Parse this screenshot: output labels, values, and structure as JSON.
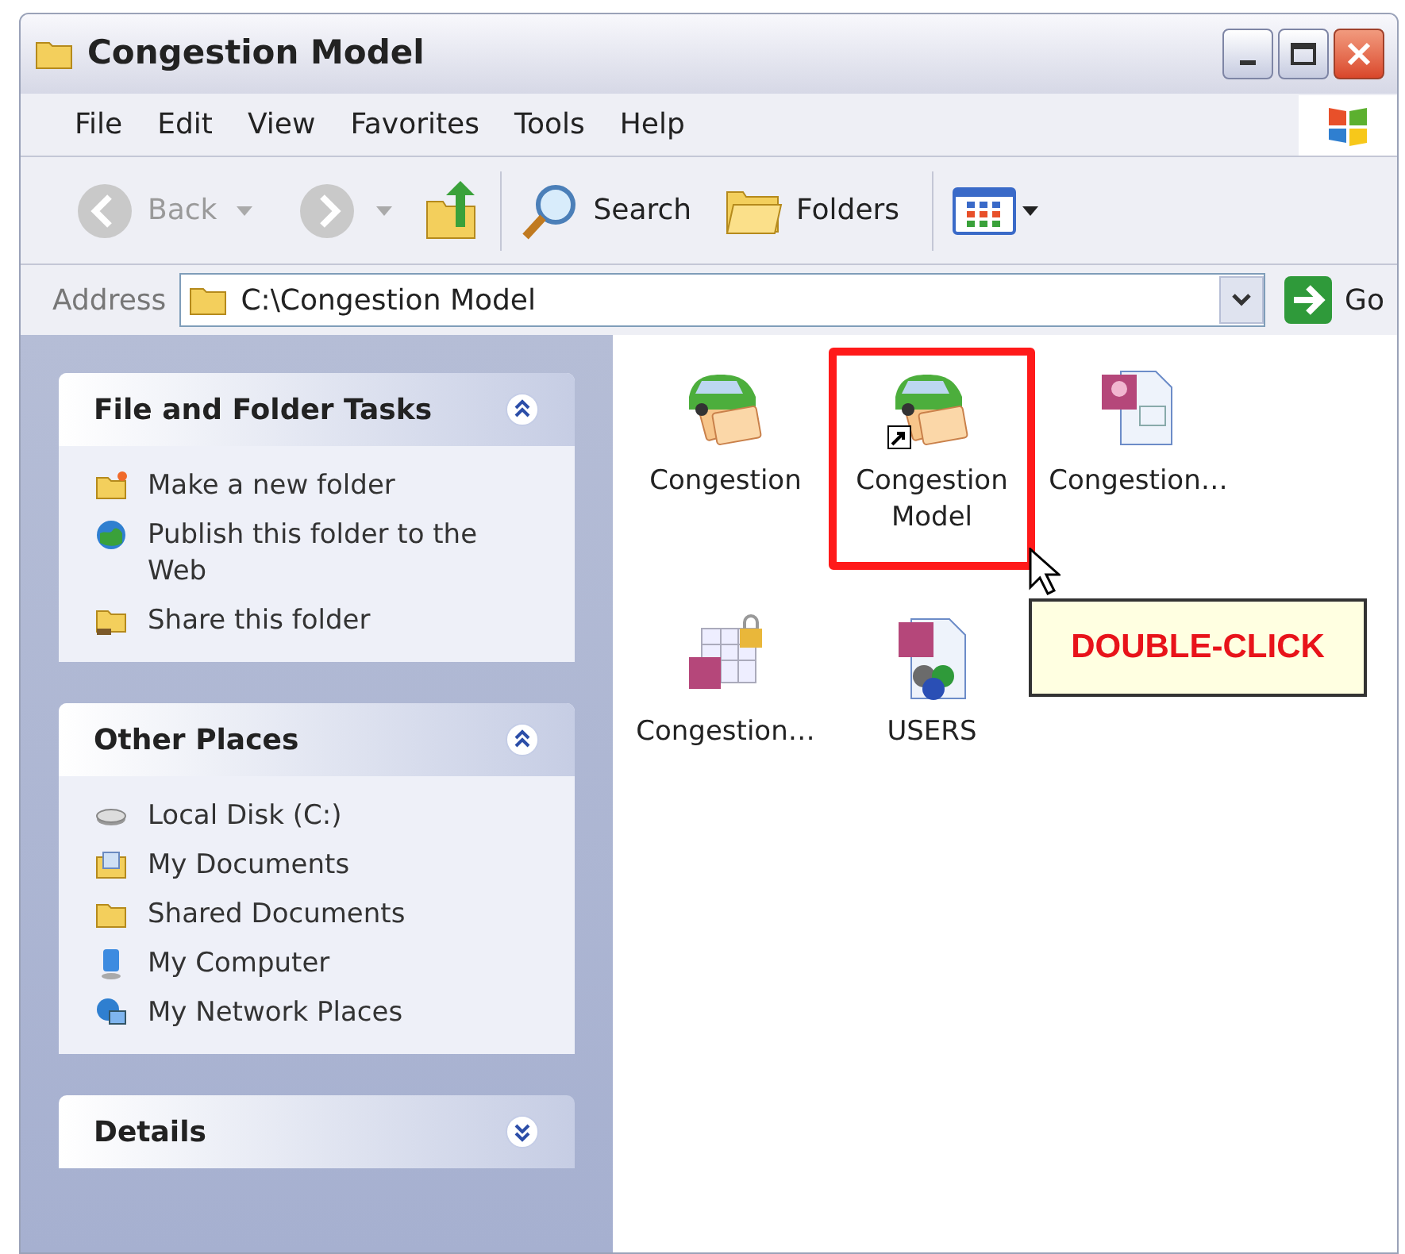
{
  "window": {
    "title": "Congestion Model"
  },
  "menu": [
    "File",
    "Edit",
    "View",
    "Favorites",
    "Tools",
    "Help"
  ],
  "toolbar": {
    "back": "Back",
    "search": "Search",
    "folders": "Folders"
  },
  "address": {
    "label": "Address",
    "value": "C:\\Congestion Model",
    "go": "Go"
  },
  "panels": [
    {
      "title": "File and Folder Tasks",
      "expanded": true,
      "items": [
        {
          "kind": "new-folder",
          "label": "Make a new folder"
        },
        {
          "kind": "globe",
          "label": "Publish this folder to the Web"
        },
        {
          "kind": "share",
          "label": "Share this folder"
        }
      ]
    },
    {
      "title": "Other Places",
      "expanded": true,
      "items": [
        {
          "kind": "disk",
          "label": "Local Disk (C:)"
        },
        {
          "kind": "documents",
          "label": "My Documents"
        },
        {
          "kind": "folder",
          "label": "Shared Documents"
        },
        {
          "kind": "computer",
          "label": "My Computer"
        },
        {
          "kind": "network",
          "label": "My Network Places"
        }
      ]
    },
    {
      "title": "Details",
      "expanded": false
    }
  ],
  "files": [
    {
      "kind": "app",
      "name": "Congestion",
      "shortcut": false,
      "highlighted": false
    },
    {
      "kind": "app",
      "name": "Congestion Model",
      "shortcut": true,
      "highlighted": true
    },
    {
      "kind": "document",
      "name": "Congestion…",
      "shortcut": false,
      "highlighted": false
    },
    {
      "kind": "table",
      "name": "Congestion…",
      "shortcut": false,
      "highlighted": false
    },
    {
      "kind": "users",
      "name": "USERS",
      "shortcut": false,
      "highlighted": false
    }
  ],
  "callout": {
    "text": "DOUBLE-CLICK"
  }
}
